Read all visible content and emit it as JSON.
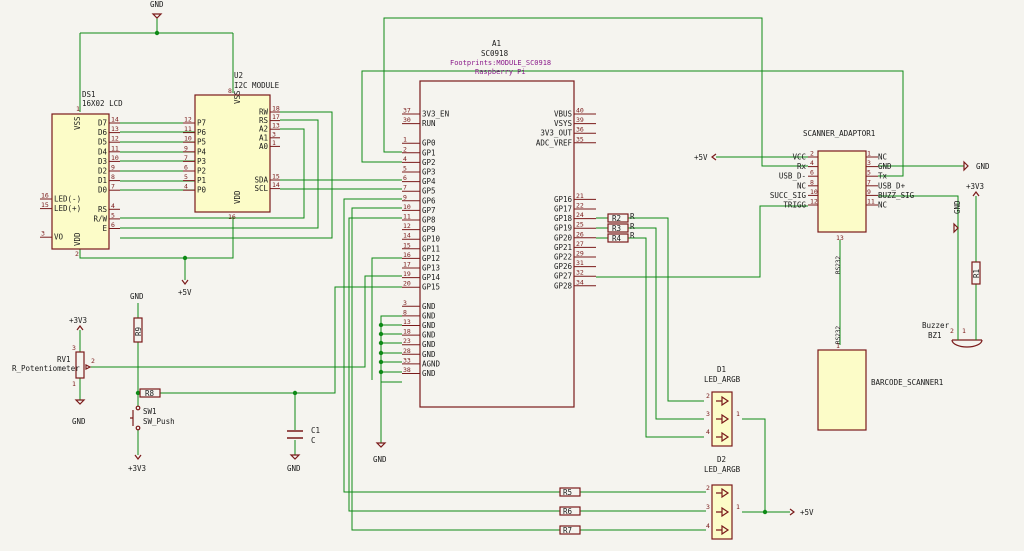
{
  "power": {
    "gnd": "GND",
    "v5": "+5V",
    "v33": "+3V3"
  },
  "ds1": {
    "ref": "DS1",
    "value": "16X02 LCD",
    "left_pins": [
      {
        "n": "16",
        "l": "LED(-)"
      },
      {
        "n": "15",
        "l": "LED(+)"
      },
      {
        "n": "3",
        "l": "VO"
      }
    ],
    "right_pins": [
      {
        "n": "14",
        "l": "D7"
      },
      {
        "n": "13",
        "l": "D6"
      },
      {
        "n": "12",
        "l": "D5"
      },
      {
        "n": "11",
        "l": "D4"
      },
      {
        "n": "10",
        "l": "D3"
      },
      {
        "n": "9",
        "l": "D2"
      },
      {
        "n": "8",
        "l": "D1"
      },
      {
        "n": "7",
        "l": "D0"
      },
      {
        "n": "4",
        "l": "RS"
      },
      {
        "n": "5",
        "l": "R/W"
      },
      {
        "n": "6",
        "l": "E"
      }
    ],
    "top": {
      "n": "1",
      "l": "VSS"
    },
    "bottom": {
      "n": "2",
      "l": "VDD"
    }
  },
  "u2": {
    "ref": "U2",
    "value": "I2C MODULE",
    "left_pins": [
      {
        "n": "12",
        "l": "P7"
      },
      {
        "n": "11",
        "l": "P6"
      },
      {
        "n": "10",
        "l": "P5"
      },
      {
        "n": "9",
        "l": "P4"
      },
      {
        "n": "7",
        "l": "P3"
      },
      {
        "n": "6",
        "l": "P2"
      },
      {
        "n": "5",
        "l": "P1"
      },
      {
        "n": "4",
        "l": "P0"
      }
    ],
    "right_pins": [
      {
        "n": "18",
        "l": "RW"
      },
      {
        "n": "17",
        "l": "RS"
      },
      {
        "n": "13",
        "l": "A2"
      },
      {
        "n": "3",
        "l": "A1"
      },
      {
        "n": "1",
        "l": "A0"
      },
      {
        "n": "15",
        "l": "SDA"
      },
      {
        "n": "14",
        "l": "SCL"
      }
    ],
    "top": {
      "n": "8",
      "l": "VSS"
    },
    "bottom": {
      "n": "16",
      "l": "VDD"
    }
  },
  "a1": {
    "ref": "A1",
    "value": "SC0918",
    "footprint": "Footprints:MODULE_SC0918",
    "desc": "Raspberry Pi",
    "left_pins": [
      {
        "n": "37",
        "l": "3V3_EN"
      },
      {
        "n": "30",
        "l": "RUN"
      },
      {
        "n": "1",
        "l": "GP0"
      },
      {
        "n": "2",
        "l": "GP1"
      },
      {
        "n": "4",
        "l": "GP2"
      },
      {
        "n": "5",
        "l": "GP3"
      },
      {
        "n": "6",
        "l": "GP4"
      },
      {
        "n": "7",
        "l": "GP5"
      },
      {
        "n": "9",
        "l": "GP6"
      },
      {
        "n": "10",
        "l": "GP7"
      },
      {
        "n": "11",
        "l": "GP8"
      },
      {
        "n": "12",
        "l": "GP9"
      },
      {
        "n": "14",
        "l": "GP10"
      },
      {
        "n": "15",
        "l": "GP11"
      },
      {
        "n": "16",
        "l": "GP12"
      },
      {
        "n": "17",
        "l": "GP13"
      },
      {
        "n": "19",
        "l": "GP14"
      },
      {
        "n": "20",
        "l": "GP15"
      },
      {
        "n": "3",
        "l": "GND"
      },
      {
        "n": "8",
        "l": "GND"
      },
      {
        "n": "13",
        "l": "GND"
      },
      {
        "n": "18",
        "l": "GND"
      },
      {
        "n": "23",
        "l": "GND"
      },
      {
        "n": "28",
        "l": "GND"
      },
      {
        "n": "33",
        "l": "AGND"
      },
      {
        "n": "38",
        "l": "GND"
      }
    ],
    "right_pins": [
      {
        "n": "40",
        "l": "VBUS"
      },
      {
        "n": "39",
        "l": "VSYS"
      },
      {
        "n": "36",
        "l": "3V3_OUT"
      },
      {
        "n": "35",
        "l": "ADC_VREF"
      },
      {
        "n": "21",
        "l": "GP16"
      },
      {
        "n": "22",
        "l": "GP17"
      },
      {
        "n": "24",
        "l": "GP18"
      },
      {
        "n": "25",
        "l": "GP19"
      },
      {
        "n": "26",
        "l": "GP20"
      },
      {
        "n": "27",
        "l": "GP21"
      },
      {
        "n": "29",
        "l": "GP22"
      },
      {
        "n": "31",
        "l": "GP26"
      },
      {
        "n": "32",
        "l": "GP27"
      },
      {
        "n": "34",
        "l": "GP28"
      }
    ]
  },
  "scanner_adaptor": {
    "ref": "SCANNER_ADAPTOR1",
    "left_pins": [
      {
        "n": "2",
        "l": "VCC"
      },
      {
        "n": "4",
        "l": "Rx"
      },
      {
        "n": "6",
        "l": "USB_D-"
      },
      {
        "n": "8",
        "l": "NC"
      },
      {
        "n": "10",
        "l": "SUCC_SIG"
      },
      {
        "n": "12",
        "l": "TRIGG"
      }
    ],
    "right_pins": [
      {
        "n": "1",
        "l": "NC"
      },
      {
        "n": "3",
        "l": "GND"
      },
      {
        "n": "5",
        "l": "Tx"
      },
      {
        "n": "7",
        "l": "USB_D+"
      },
      {
        "n": "9",
        "l": "BUZZ_SIG"
      },
      {
        "n": "11",
        "l": "NC"
      }
    ],
    "bottom": {
      "n": "13",
      "l": "RS232"
    }
  },
  "barcode": {
    "ref": "BARCODE_SCANNER1",
    "top": {
      "n": "1",
      "l": "RS232"
    }
  },
  "resistors": {
    "r1": "R1",
    "r2": "R2",
    "r3": "R3",
    "r4": "R4",
    "r5": "R5",
    "r6": "R6",
    "r7": "R7",
    "r8": "R8",
    "r9": "R9",
    "rlabel": "R"
  },
  "rv1": {
    "ref": "RV1",
    "value": "R_Potentiometer",
    "p1": "1",
    "p2": "2",
    "p3": "3"
  },
  "sw1": {
    "ref": "SW1",
    "value": "SW_Push"
  },
  "c1": {
    "ref": "C1",
    "value": "C"
  },
  "bz1": {
    "ref": "BZ1",
    "value": "Buzzer",
    "p1": "1",
    "p2": "2"
  },
  "d1": {
    "ref": "D1",
    "value": "LED_ARGB",
    "p2": "2",
    "p3": "3",
    "p4": "4",
    "p1": "1"
  },
  "d2": {
    "ref": "D2",
    "value": "LED_ARGB",
    "p2": "2",
    "p3": "3",
    "p4": "4",
    "p1": "1"
  }
}
